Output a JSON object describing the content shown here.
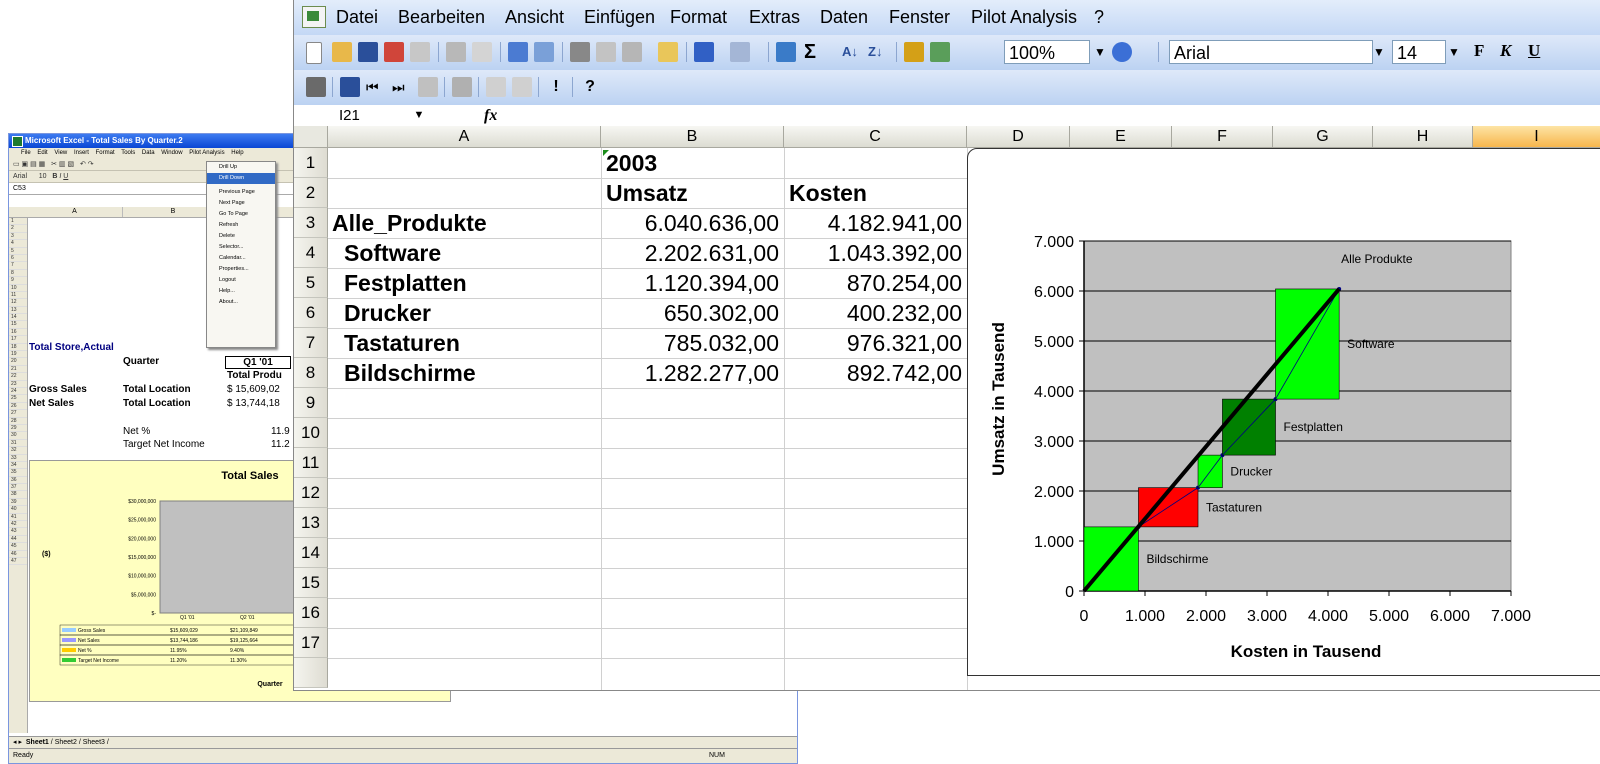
{
  "bg_window": {
    "title": "Microsoft Excel - Total Sales By Quarter.2",
    "menu": [
      "File",
      "Edit",
      "View",
      "Insert",
      "Format",
      "Tools",
      "Data",
      "Window",
      "Pilot Analysis",
      "Help"
    ],
    "font": "Arial",
    "font_size": "10",
    "name_box": "C53",
    "columns": [
      "A",
      "B"
    ],
    "dropdown": [
      "Drill Up",
      "Drill Down",
      "Previous Page",
      "Next Page",
      "Go To Page",
      "Refresh",
      "Delete",
      "Selector...",
      "Calendar...",
      "Properties...",
      "Logout",
      "Help...",
      "About..."
    ],
    "cells": {
      "store": "Total Store,Actual",
      "quarter_label": "Quarter",
      "q1": "Q1 '01",
      "total_product": "Total Produ",
      "gross_sales": "Gross Sales",
      "net_sales": "Net Sales",
      "total_location_1": "Total Location",
      "total_location_2": "Total Location",
      "gross_value": "$  15,609,02",
      "net_value": "$  13,744,18",
      "net_pct": "Net %",
      "net_pct_val": "11.9",
      "target_income": "Target Net Income",
      "target_val": "11.2"
    },
    "chart": {
      "title": "Total Sales",
      "y_unit": "($)",
      "xlabel": "Quarter",
      "y_ticks": [
        "$30,000,000",
        "$25,000,000",
        "$20,000,000",
        "$15,000,000",
        "$10,000,000",
        "$5,000,000",
        "$-"
      ],
      "categories": [
        "Q1 '01",
        "Q2 '01"
      ],
      "table": [
        {
          "name": "Gross Sales",
          "v1": "$15,609,029",
          "v2": "$21,109,849",
          "color": "#99ccff"
        },
        {
          "name": "Net Sales",
          "v1": "$13,744,186",
          "v2": "$19,125,664",
          "color": "#9999ff"
        },
        {
          "name": "Net %",
          "v1": "11.95%",
          "v2": "9.40%",
          "color": "#ffcc00"
        },
        {
          "name": "Target Net Income",
          "v1": "11.20%",
          "v2": "11.30%",
          "color": "#33cc33"
        }
      ]
    },
    "sheets": [
      "Sheet1",
      "Sheet2",
      "Sheet3"
    ],
    "status": "Ready",
    "num": "NUM"
  },
  "menubar": [
    "Datei",
    "Bearbeiten",
    "Ansicht",
    "Einfügen",
    "Format",
    "Extras",
    "Daten",
    "Fenster",
    "Pilot Analysis",
    "?"
  ],
  "zoom": "100%",
  "font_name": "Arial",
  "font_size": "14",
  "format_buttons": [
    "F",
    "K",
    "U"
  ],
  "name_box": "I21",
  "fx_label": "fx",
  "columns": [
    "A",
    "B",
    "C",
    "D",
    "E",
    "F",
    "G",
    "H",
    "I"
  ],
  "rows": [
    "1",
    "2",
    "3",
    "4",
    "5",
    "6",
    "7",
    "8",
    "9",
    "10",
    "11",
    "12",
    "13",
    "14",
    "15",
    "16",
    "17"
  ],
  "sheet": {
    "year": "2003",
    "col_b_header": "Umsatz",
    "col_c_header": "Kosten",
    "data": [
      {
        "name": "Alle_Produkte",
        "umsatz": "6.040.636,00",
        "kosten": "4.182.941,00"
      },
      {
        "name": "Software",
        "umsatz": "2.202.631,00",
        "kosten": "1.043.392,00"
      },
      {
        "name": "Festplatten",
        "umsatz": "1.120.394,00",
        "kosten": "870.254,00"
      },
      {
        "name": "Drucker",
        "umsatz": "650.302,00",
        "kosten": "400.232,00"
      },
      {
        "name": "Tastaturen",
        "umsatz": "785.032,00",
        "kosten": "976.321,00"
      },
      {
        "name": "Bildschirme",
        "umsatz": "1.282.277,00",
        "kosten": "892.742,00"
      }
    ]
  },
  "chart_data": {
    "type": "scatter",
    "xlabel": "Kosten in Tausend",
    "ylabel": "Umsatz in Tausend",
    "xlim": [
      0,
      7000
    ],
    "ylim": [
      0,
      7000
    ],
    "x_ticks": [
      "0",
      "1.000",
      "2.000",
      "3.000",
      "4.000",
      "5.000",
      "6.000",
      "7.000"
    ],
    "y_ticks": [
      "0",
      "1.000",
      "2.000",
      "3.000",
      "4.000",
      "5.000",
      "6.000",
      "7.000"
    ],
    "grid": true,
    "total": {
      "name": "Alle Produkte",
      "x": 4182.941,
      "y": 6040.636
    },
    "boxes": [
      {
        "name": "Bildschirme",
        "kosten": 892.742,
        "umsatz": 1282.277,
        "color": "#00ff00"
      },
      {
        "name": "Tastaturen",
        "kosten": 976.321,
        "umsatz": 785.032,
        "color": "#ff0000"
      },
      {
        "name": "Drucker",
        "kosten": 400.232,
        "umsatz": 650.302,
        "color": "#00ff00"
      },
      {
        "name": "Festplatten",
        "kosten": 870.254,
        "umsatz": 1120.394,
        "color": "#008000"
      },
      {
        "name": "Software",
        "kosten": 1043.392,
        "umsatz": 2202.631,
        "color": "#00ff00"
      }
    ]
  }
}
